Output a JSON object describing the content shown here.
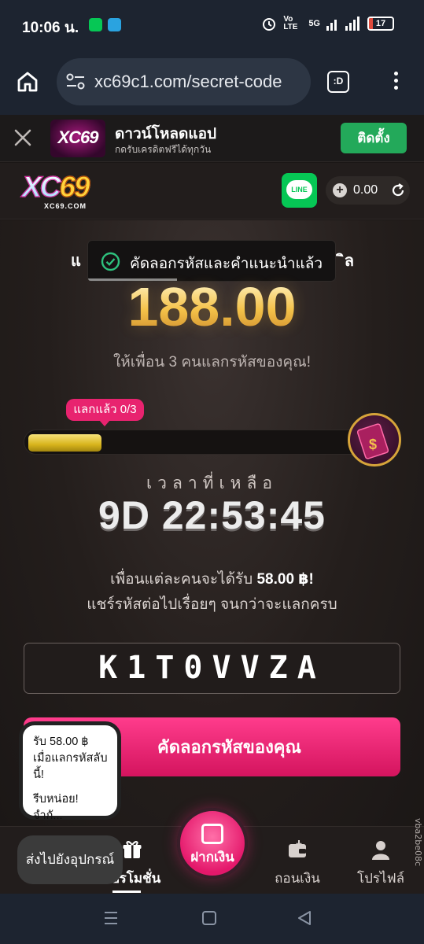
{
  "status_bar": {
    "time": "10:06 น.",
    "network_label": "Vo LTE",
    "signal_label": "5G",
    "battery": "17",
    "battery_level": 0.17
  },
  "browser": {
    "url": "xc69c1.com/secret-code",
    "tab_label": ":D"
  },
  "app_banner": {
    "title": "ดาวน์โหลดแอป",
    "subtitle": "กดรับเครดิตฟรีได้ทุกวัน",
    "logo_text": "XC69",
    "install_label": "ติดตั้ง"
  },
  "site_header": {
    "logo_text": "XC",
    "logo_number": "69",
    "logo_domain": "XC69.COM",
    "line_label": "LINE",
    "balance": "0.00"
  },
  "promo": {
    "title_left": "แ",
    "title_right": "ิล",
    "toast_message": "คัดลอกรหัสและคำแนะนำแล้ว",
    "amount": "188.00",
    "invite_text": "ให้เพื่อน 3 คนแลกรหัสของคุณ!",
    "redeemed_badge": "แลกแล้ว 0/3",
    "progress_fraction": 0.22,
    "time_left_label": "เวลาที่เหลือ",
    "countdown": "9D 22:53:45",
    "reward_prefix": "เพื่อนแต่ละคนจะได้รับ ",
    "reward_amount": "58.00 ฿!",
    "share_text": "แชร์รหัสต่อไปเรื่อยๆ จนกว่าจะแลกครบ",
    "code": "K1T0VVZA",
    "copy_button": "คัดลอกรหัสของคุณ"
  },
  "notification_popup": {
    "line1": "รับ 58.00 ฿ เมื่อแลกรหัสลับนี้!",
    "line2": "รีบหน่อย! จำกั..."
  },
  "bottom_nav": {
    "promotion": "โปรโมชั่น",
    "deposit": "ฝากเงิน",
    "withdraw": "ถอนเงิน",
    "profile": "โปรไฟล์"
  },
  "side_tag": "vba2be08c",
  "send_to_device": "ส่งไปยังอุปกรณ์"
}
